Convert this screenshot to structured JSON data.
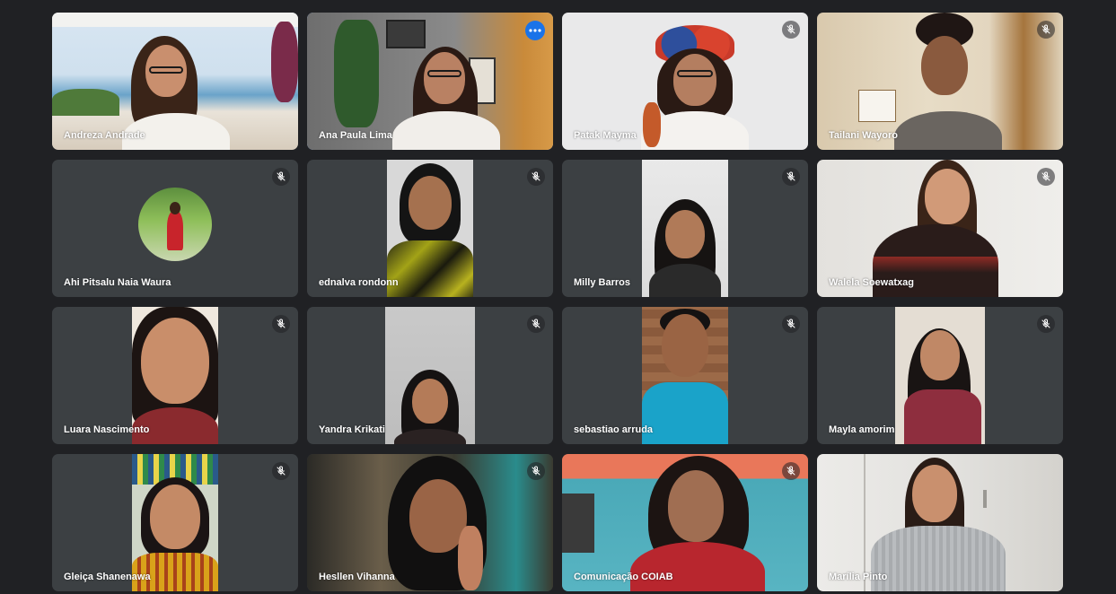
{
  "participants": [
    {
      "name": "Andreza Andrade",
      "muted": false
    },
    {
      "name": "Ana Paula Lima",
      "muted": false,
      "speaking": true,
      "more_icon": "more-options-icon"
    },
    {
      "name": "Patak Mayma",
      "muted": true
    },
    {
      "name": "Tailani Wayoro",
      "muted": true
    },
    {
      "name": "Ahi Pitsalu Naia Waura",
      "muted": true,
      "avatar": true
    },
    {
      "name": "ednalva rondonn",
      "muted": true
    },
    {
      "name": "Milly Barros",
      "muted": true
    },
    {
      "name": "Walela Soewatxag",
      "muted": true
    },
    {
      "name": "Luara Nascimento",
      "muted": true
    },
    {
      "name": "Yandra Krikati",
      "muted": true
    },
    {
      "name": "sebastiao arruda",
      "muted": true
    },
    {
      "name": "Mayla amorim",
      "muted": true
    },
    {
      "name": "Gleiça Shanenawa",
      "muted": true
    },
    {
      "name": "Hesllen Vihanna",
      "muted": true
    },
    {
      "name": "Comunicação COIAB",
      "muted": true
    },
    {
      "name": "Marília Pinto",
      "muted": false
    }
  ],
  "colors": {
    "background": "#202124",
    "tile": "#3c4043",
    "active_speaker_border": "#8ab4f8",
    "more_button": "#1a73e8"
  },
  "icons": {
    "mute": "mic-off-icon",
    "more": "more-options-icon"
  }
}
